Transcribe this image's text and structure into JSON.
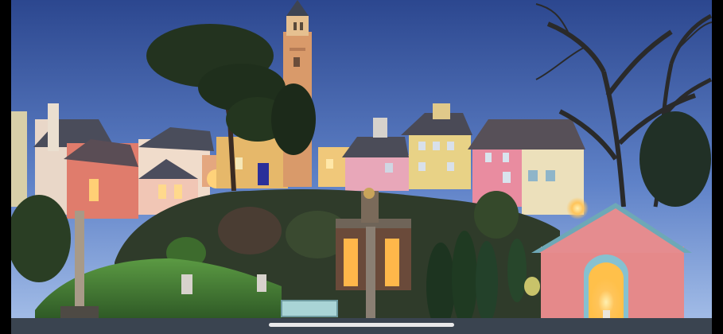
{
  "photo": {
    "subject": "village-at-dusk",
    "sky_top": "#2f4ea0",
    "sky_bottom": "#8fb0e2",
    "wall_pink": "#e58a8c",
    "wall_yellow": "#e8cf86",
    "roof_dark": "#4b4b57",
    "lamp_glow": "#ffd27a",
    "grass": "#4d8a3a"
  },
  "ui": {
    "home_indicator_color": "#f2f2f2"
  }
}
